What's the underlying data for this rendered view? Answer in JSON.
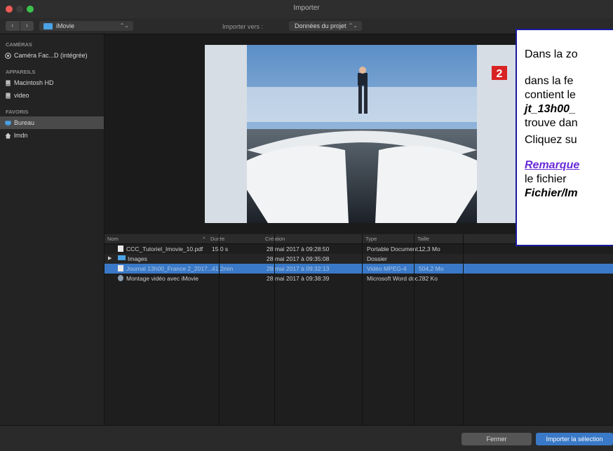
{
  "window": {
    "title": "Importer",
    "traffic_lights": [
      "#ee5b56",
      "#3e3e3e",
      "#3cc24c"
    ]
  },
  "toolbar": {
    "back_icon": "chevron-left",
    "forward_icon": "chevron-right",
    "back": "‹",
    "forward": "›",
    "location": "iMovie",
    "import_to_label": "Importer vers :",
    "destination": "Données du projet",
    "updown": "⌃⌄"
  },
  "sidebar": {
    "sections": [
      {
        "title": "CAMÉRAS",
        "items": [
          {
            "label": "Caméra Fac...D (intégrée)",
            "icon": "camera-icon"
          }
        ]
      },
      {
        "title": "APPAREILS",
        "items": [
          {
            "label": "Macintosh HD",
            "icon": "disk-icon"
          },
          {
            "label": "video",
            "icon": "disk-icon"
          }
        ]
      },
      {
        "title": "FAVORIS",
        "items": [
          {
            "label": "Bureau",
            "icon": "desktop-icon",
            "selected": true
          },
          {
            "label": "lmdn",
            "icon": "home-icon"
          }
        ]
      }
    ]
  },
  "preview": {
    "channel_logo": "2"
  },
  "table": {
    "headers": {
      "name": "Nom",
      "duration": "Durée",
      "sort_indicator": "^",
      "created": "Création",
      "type": "Type",
      "size": "Taille"
    },
    "rows": [
      {
        "name": "CCC_Tutoriel_Imovie_10.pdf",
        "duration": "15,0 s",
        "created": "28 mai 2017 à 09:28:50",
        "type": "Portable Document...",
        "size": "12,3 Mo",
        "kind": "file"
      },
      {
        "name": "Images",
        "duration": "",
        "created": "28 mai 2017 à 09:35:08",
        "type": "Dossier",
        "size": "",
        "kind": "folder",
        "expander": "▶"
      },
      {
        "name": "Journal 13h00_France 2_2017...",
        "duration": "41,2min",
        "created": "28 mai 2017 à 09:32:13",
        "type": "Vidéo MPEG-4",
        "size": "504,2 Mo",
        "kind": "file",
        "selected": true
      },
      {
        "name": "Montage vidéo avec iMovie",
        "duration": "",
        "created": "28 mai 2017 à 09:38:39",
        "type": "Microsoft Word doc...",
        "size": "782 Ko",
        "kind": "doc"
      }
    ]
  },
  "footer": {
    "close_label": "Fermer",
    "import_label": "Importer la sélection"
  },
  "callout": {
    "line1": "Dans la zo",
    "line2": "dans  la  fe",
    "line3": "contient le",
    "line4": "jt_13h00_",
    "line5": "trouve dan",
    "line6": "Cliquez su",
    "line7": "Remarque",
    "line8": "le   fichier",
    "line9": "Fichier/Im"
  },
  "colors": {
    "accent": "#3a79c7",
    "callout_border": "#1a1aa0",
    "remark": "#6a2bd9"
  }
}
